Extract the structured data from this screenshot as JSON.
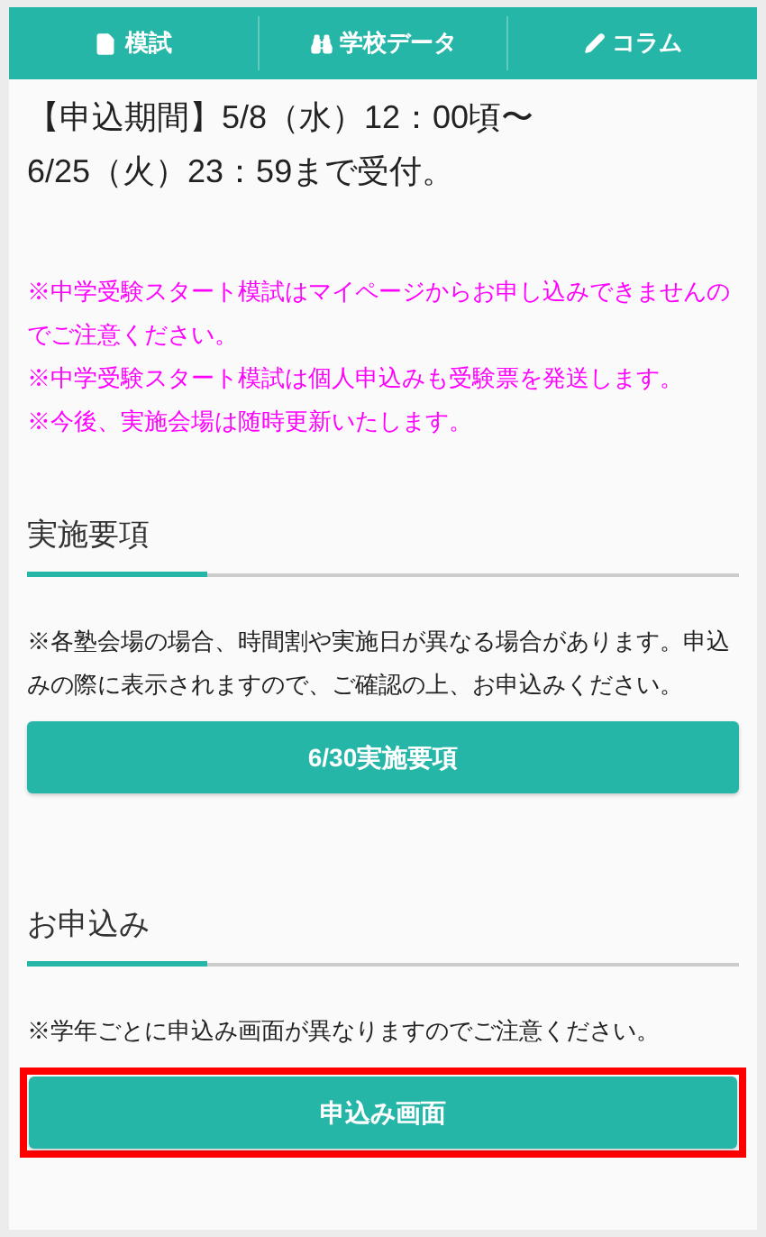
{
  "nav": [
    {
      "kind": "file",
      "label": "模試"
    },
    {
      "kind": "binoculars",
      "label": "学校データ"
    },
    {
      "kind": "pencil",
      "label": "コラム"
    }
  ],
  "period": [
    "【申込期間】5/8（水）12：00頃〜",
    "6/25（火）23：59まで受付。"
  ],
  "notices": [
    "※中学受験スタート模試はマイページからお申し込みできませんのでご注意ください。",
    "※中学受験スタート模試は個人申込みも受験票を発送します。",
    "※今後、実施会場は随時更新いたします。"
  ],
  "sections": [
    {
      "heading": "実施要項",
      "text": "※各塾会場の場合、時間割や実施日が異なる場合があります。申込みの際に表示されますので、ご確認の上、お申込みください。",
      "button": {
        "label": "6/30実施要項",
        "highlighted": false
      }
    },
    {
      "heading": "お申込み",
      "text": "※学年ごとに申込み画面が異なりますのでご注意ください。",
      "button": {
        "label": "申込み画面",
        "highlighted": true
      }
    }
  ]
}
